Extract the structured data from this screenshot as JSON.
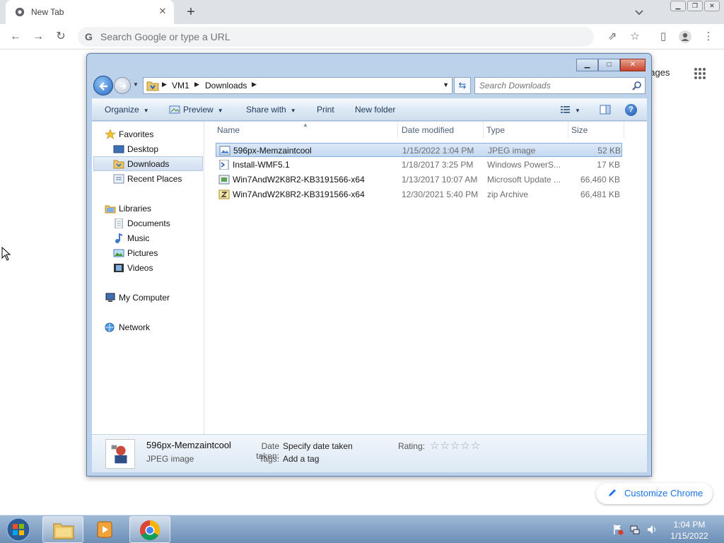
{
  "chrome": {
    "tab_title": "New Tab",
    "omnibox_placeholder": "Search Google or type a URL",
    "images_link": "Images",
    "images_visible": "nages",
    "customize_label": "Customize Chrome"
  },
  "explorer": {
    "breadcrumb": [
      "VM1",
      "Downloads"
    ],
    "search_placeholder": "Search Downloads",
    "commands": {
      "organize": "Organize",
      "preview": "Preview",
      "share_with": "Share with",
      "print": "Print",
      "new_folder": "New folder"
    },
    "nav": {
      "favorites": "Favorites",
      "desktop": "Desktop",
      "downloads": "Downloads",
      "recent_places": "Recent Places",
      "libraries": "Libraries",
      "documents": "Documents",
      "music": "Music",
      "pictures": "Pictures",
      "videos": "Videos",
      "my_computer": "My Computer",
      "network": "Network"
    },
    "columns": {
      "name": "Name",
      "date_modified": "Date modified",
      "type": "Type",
      "size": "Size"
    },
    "files": [
      {
        "name": "596px-Memzaintcool",
        "date": "1/15/2022 1:04 PM",
        "type": "JPEG image",
        "size": "52 KB",
        "icon": "jpeg-icon",
        "selected": true
      },
      {
        "name": "Install-WMF5.1",
        "date": "1/18/2017 3:25 PM",
        "type": "Windows PowerS...",
        "size": "17 KB",
        "icon": "powershell-script-icon",
        "selected": false
      },
      {
        "name": "Win7AndW2K8R2-KB3191566-x64",
        "date": "1/13/2017 10:07 AM",
        "type": "Microsoft Update ...",
        "size": "66,460 KB",
        "icon": "msu-icon",
        "selected": false
      },
      {
        "name": "Win7AndW2K8R2-KB3191566-x64",
        "date": "12/30/2021 5:40 PM",
        "type": "zip Archive",
        "size": "66,481 KB",
        "icon": "zip-icon",
        "selected": false
      }
    ],
    "details": {
      "name": "596px-Memzaintcool",
      "type": "JPEG image",
      "date_taken_label": "Date taken:",
      "date_taken_value": "Specify date taken",
      "tags_label": "Tags:",
      "tags_value": "Add a tag",
      "rating_label": "Rating:",
      "rating_value": 0
    }
  },
  "taskbar": {
    "time": "1:04 PM",
    "date": "1/15/2022"
  }
}
